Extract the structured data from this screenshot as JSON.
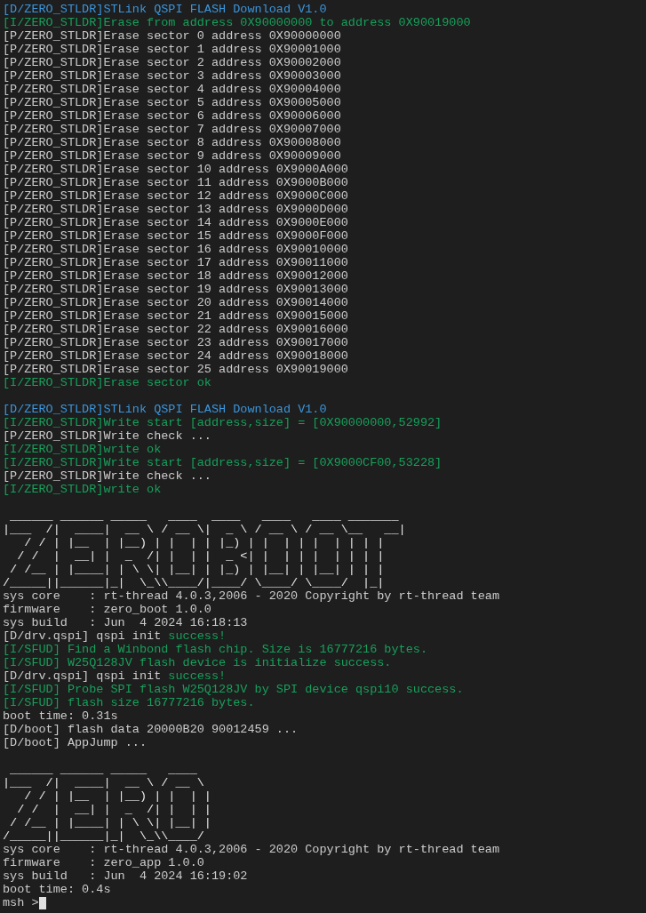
{
  "terminal": {
    "blocks": [
      {
        "kind": "line",
        "segments": [
          {
            "text": "[D/ZERO_STLDR]STLink QSPI FLASH Download V1.0",
            "color": "#3a96dd"
          }
        ]
      },
      {
        "kind": "line",
        "segments": [
          {
            "text": "[I/ZERO_STLDR]Erase from address 0X90000000 to address 0X90019000",
            "color": "#16a05a"
          }
        ]
      },
      {
        "kind": "line",
        "segments": [
          {
            "text": "[P/ZERO_STLDR]Erase sector 0 address 0X90000000",
            "color": "#cccccc"
          }
        ]
      },
      {
        "kind": "line",
        "segments": [
          {
            "text": "[P/ZERO_STLDR]Erase sector 1 address 0X90001000",
            "color": "#cccccc"
          }
        ]
      },
      {
        "kind": "line",
        "segments": [
          {
            "text": "[P/ZERO_STLDR]Erase sector 2 address 0X90002000",
            "color": "#cccccc"
          }
        ]
      },
      {
        "kind": "line",
        "segments": [
          {
            "text": "[P/ZERO_STLDR]Erase sector 3 address 0X90003000",
            "color": "#cccccc"
          }
        ]
      },
      {
        "kind": "line",
        "segments": [
          {
            "text": "[P/ZERO_STLDR]Erase sector 4 address 0X90004000",
            "color": "#cccccc"
          }
        ]
      },
      {
        "kind": "line",
        "segments": [
          {
            "text": "[P/ZERO_STLDR]Erase sector 5 address 0X90005000",
            "color": "#cccccc"
          }
        ]
      },
      {
        "kind": "line",
        "segments": [
          {
            "text": "[P/ZERO_STLDR]Erase sector 6 address 0X90006000",
            "color": "#cccccc"
          }
        ]
      },
      {
        "kind": "line",
        "segments": [
          {
            "text": "[P/ZERO_STLDR]Erase sector 7 address 0X90007000",
            "color": "#cccccc"
          }
        ]
      },
      {
        "kind": "line",
        "segments": [
          {
            "text": "[P/ZERO_STLDR]Erase sector 8 address 0X90008000",
            "color": "#cccccc"
          }
        ]
      },
      {
        "kind": "line",
        "segments": [
          {
            "text": "[P/ZERO_STLDR]Erase sector 9 address 0X90009000",
            "color": "#cccccc"
          }
        ]
      },
      {
        "kind": "line",
        "segments": [
          {
            "text": "[P/ZERO_STLDR]Erase sector 10 address 0X9000A000",
            "color": "#cccccc"
          }
        ]
      },
      {
        "kind": "line",
        "segments": [
          {
            "text": "[P/ZERO_STLDR]Erase sector 11 address 0X9000B000",
            "color": "#cccccc"
          }
        ]
      },
      {
        "kind": "line",
        "segments": [
          {
            "text": "[P/ZERO_STLDR]Erase sector 12 address 0X9000C000",
            "color": "#cccccc"
          }
        ]
      },
      {
        "kind": "line",
        "segments": [
          {
            "text": "[P/ZERO_STLDR]Erase sector 13 address 0X9000D000",
            "color": "#cccccc"
          }
        ]
      },
      {
        "kind": "line",
        "segments": [
          {
            "text": "[P/ZERO_STLDR]Erase sector 14 address 0X9000E000",
            "color": "#cccccc"
          }
        ]
      },
      {
        "kind": "line",
        "segments": [
          {
            "text": "[P/ZERO_STLDR]Erase sector 15 address 0X9000F000",
            "color": "#cccccc"
          }
        ]
      },
      {
        "kind": "line",
        "segments": [
          {
            "text": "[P/ZERO_STLDR]Erase sector 16 address 0X90010000",
            "color": "#cccccc"
          }
        ]
      },
      {
        "kind": "line",
        "segments": [
          {
            "text": "[P/ZERO_STLDR]Erase sector 17 address 0X90011000",
            "color": "#cccccc"
          }
        ]
      },
      {
        "kind": "line",
        "segments": [
          {
            "text": "[P/ZERO_STLDR]Erase sector 18 address 0X90012000",
            "color": "#cccccc"
          }
        ]
      },
      {
        "kind": "line",
        "segments": [
          {
            "text": "[P/ZERO_STLDR]Erase sector 19 address 0X90013000",
            "color": "#cccccc"
          }
        ]
      },
      {
        "kind": "line",
        "segments": [
          {
            "text": "[P/ZERO_STLDR]Erase sector 20 address 0X90014000",
            "color": "#cccccc"
          }
        ]
      },
      {
        "kind": "line",
        "segments": [
          {
            "text": "[P/ZERO_STLDR]Erase sector 21 address 0X90015000",
            "color": "#cccccc"
          }
        ]
      },
      {
        "kind": "line",
        "segments": [
          {
            "text": "[P/ZERO_STLDR]Erase sector 22 address 0X90016000",
            "color": "#cccccc"
          }
        ]
      },
      {
        "kind": "line",
        "segments": [
          {
            "text": "[P/ZERO_STLDR]Erase sector 23 address 0X90017000",
            "color": "#cccccc"
          }
        ]
      },
      {
        "kind": "line",
        "segments": [
          {
            "text": "[P/ZERO_STLDR]Erase sector 24 address 0X90018000",
            "color": "#cccccc"
          }
        ]
      },
      {
        "kind": "line",
        "segments": [
          {
            "text": "[P/ZERO_STLDR]Erase sector 25 address 0X90019000",
            "color": "#cccccc"
          }
        ]
      },
      {
        "kind": "line",
        "segments": [
          {
            "text": "[I/ZERO_STLDR]Erase sector ok",
            "color": "#16a05a"
          }
        ]
      },
      {
        "kind": "blank"
      },
      {
        "kind": "line",
        "segments": [
          {
            "text": "[D/ZERO_STLDR]STLink QSPI FLASH Download V1.0",
            "color": "#3a96dd"
          }
        ]
      },
      {
        "kind": "line",
        "segments": [
          {
            "text": "[I/ZERO_STLDR]Write start [address,size] = [0X90000000,52992]",
            "color": "#16a05a"
          }
        ]
      },
      {
        "kind": "line",
        "segments": [
          {
            "text": "[P/ZERO_STLDR]Write check ...",
            "color": "#cccccc"
          }
        ]
      },
      {
        "kind": "line",
        "segments": [
          {
            "text": "[I/ZERO_STLDR]write ok",
            "color": "#16a05a"
          }
        ]
      },
      {
        "kind": "line",
        "segments": [
          {
            "text": "[I/ZERO_STLDR]Write start [address,size] = [0X9000CF00,53228]",
            "color": "#16a05a"
          }
        ]
      },
      {
        "kind": "line",
        "segments": [
          {
            "text": "[P/ZERO_STLDR]Write check ...",
            "color": "#cccccc"
          }
        ]
      },
      {
        "kind": "line",
        "segments": [
          {
            "text": "[I/ZERO_STLDR]write ok",
            "color": "#16a05a"
          }
        ]
      },
      {
        "kind": "blank"
      },
      {
        "kind": "art",
        "rows": [
          " ______ ______ _____   ____  ____   ____   ____ _______ ",
          "|___  /|  ____|  __ \\ / __ \\|  _ \\ / __ \\ / __ \\__   __|",
          "   / / | |__  | |__) | |  | | |_) | |  | | |  | | | |   ",
          "  / /  |  __| |  _  /| |  | |  _ <| |  | | |  | | | |   ",
          " / /__ | |____| | \\ \\| |__| | |_) | |__| | |__| | | |   ",
          "/_____||______|_|  \\_\\\\____/|____/ \\____/ \\____/  |_|   "
        ]
      },
      {
        "kind": "line",
        "segments": [
          {
            "text": "sys core    : rt-thread 4.0.3,2006 - 2020 Copyright by rt-thread team",
            "color": "#cccccc"
          }
        ]
      },
      {
        "kind": "line",
        "segments": [
          {
            "text": "firmware    : zero_boot 1.0.0",
            "color": "#cccccc"
          }
        ]
      },
      {
        "kind": "line",
        "segments": [
          {
            "text": "sys build   : Jun  4 2024 16:18:13",
            "color": "#cccccc"
          }
        ]
      },
      {
        "kind": "line",
        "segments": [
          {
            "text": "[D/drv.qspi] qspi init ",
            "color": "#cccccc"
          },
          {
            "text": "success!",
            "color": "#16a05a"
          }
        ]
      },
      {
        "kind": "line",
        "segments": [
          {
            "text": "[I/SFUD] Find a Winbond flash chip. Size is 16777216 bytes.",
            "color": "#16a05a"
          }
        ]
      },
      {
        "kind": "line",
        "segments": [
          {
            "text": "[I/SFUD] W25Q128JV flash device is initialize success.",
            "color": "#16a05a"
          }
        ]
      },
      {
        "kind": "line",
        "segments": [
          {
            "text": "[D/drv.qspi] qspi init ",
            "color": "#cccccc"
          },
          {
            "text": "success!",
            "color": "#16a05a"
          }
        ]
      },
      {
        "kind": "line",
        "segments": [
          {
            "text": "[I/SFUD] Probe SPI flash W25Q128JV by SPI device qspi10 success.",
            "color": "#16a05a"
          }
        ]
      },
      {
        "kind": "line",
        "segments": [
          {
            "text": "[I/SFUD] flash size 16777216 bytes.",
            "color": "#16a05a"
          }
        ]
      },
      {
        "kind": "line",
        "segments": [
          {
            "text": "boot time: 0.31s",
            "color": "#cccccc"
          }
        ]
      },
      {
        "kind": "line",
        "segments": [
          {
            "text": "[D/boot] flash data 20000B20 90012459 ...",
            "color": "#cccccc"
          }
        ]
      },
      {
        "kind": "line",
        "segments": [
          {
            "text": "[D/boot] AppJump ...",
            "color": "#cccccc"
          }
        ]
      },
      {
        "kind": "blank"
      },
      {
        "kind": "art",
        "rows": [
          " ______ ______ _____   ____  ",
          "|___  /|  ____|  __ \\ / __ \\ ",
          "   / / | |__  | |__) | |  | |",
          "  / /  |  __| |  _  /| |  | |",
          " / /__ | |____| | \\ \\| |__| |",
          "/_____||______|_|  \\_\\\\____/ "
        ]
      },
      {
        "kind": "line",
        "segments": [
          {
            "text": "sys core    : rt-thread 4.0.3,2006 - 2020 Copyright by rt-thread team",
            "color": "#cccccc"
          }
        ]
      },
      {
        "kind": "line",
        "segments": [
          {
            "text": "firmware    : zero_app 1.0.0",
            "color": "#cccccc"
          }
        ]
      },
      {
        "kind": "line",
        "segments": [
          {
            "text": "sys build   : Jun  4 2024 16:19:02",
            "color": "#cccccc"
          }
        ]
      },
      {
        "kind": "line",
        "segments": [
          {
            "text": "boot time: 0.4s",
            "color": "#cccccc"
          }
        ]
      }
    ],
    "prompt": {
      "text": "msh >",
      "cursor": true
    }
  }
}
